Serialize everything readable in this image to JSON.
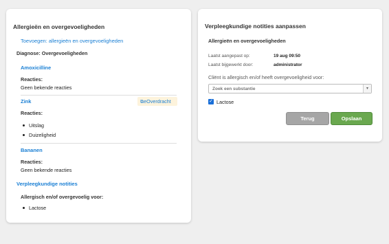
{
  "left": {
    "title": "Allergieën en overgevoeligheden",
    "add_link": "Toevoegen: allergieën en overgevoeligheden",
    "diagnosis": "Diagnose: Overgevoeligheden",
    "items": [
      {
        "name": "Amoxicilline",
        "reactions_label": "Reacties:",
        "reactions_text": "Geen bekende reacties"
      },
      {
        "name": "Zink",
        "eoverdracht": "eOverdracht",
        "reactions_label": "Reacties:",
        "reactions": [
          "Uitslag",
          "Duizeligheid"
        ]
      },
      {
        "name": "Bananen",
        "reactions_label": "Reacties:",
        "reactions_text": "Geen bekende reacties"
      }
    ],
    "notes_title": "Verpleegkundige notities",
    "notes_label": "Allergisch en/of overgevoelig voor:",
    "notes_items": [
      "Lactose"
    ]
  },
  "right": {
    "title": "Verpleegkundige notities aanpassen",
    "subtitle": "Allergieën en overgevoeligheden",
    "last_modified_label": "Laatst aangepast op:",
    "last_modified_value": "19 aug 09:50",
    "last_updated_label": "Laatst bijgewerkt door:",
    "last_updated_value": "administrator",
    "question": "Cliënt is allergisch en/of heeft overgevoeligheid voor:",
    "search_placeholder": "Zoek een substantie",
    "checkbox_label": "Lactose",
    "checkbox_checked": true,
    "back_button": "Terug",
    "save_button": "Opslaan"
  },
  "colors": {
    "link": "#1a7fd4",
    "save": "#6aa84f",
    "back": "#a6a6a6",
    "badge_bg": "#fdf3dc"
  }
}
